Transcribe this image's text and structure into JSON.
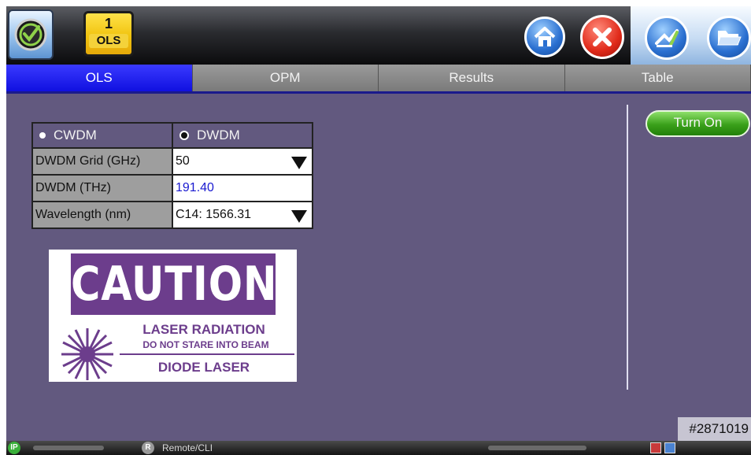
{
  "header": {
    "test_number": "1",
    "test_label": "OLS",
    "icons": [
      "logo-check-icon",
      "home-icon",
      "close-icon",
      "quick-launch-icon",
      "folder-icon"
    ]
  },
  "tabs": [
    {
      "label": "OLS",
      "active": true
    },
    {
      "label": "OPM",
      "active": false
    },
    {
      "label": "Results",
      "active": false
    },
    {
      "label": "Table",
      "active": false
    }
  ],
  "form": {
    "mode_options": [
      {
        "label": "CWDM",
        "selected": false
      },
      {
        "label": "DWDM",
        "selected": true
      }
    ],
    "grid_label": "DWDM Grid (GHz)",
    "grid_value": "50",
    "thz_label": "DWDM (THz)",
    "thz_value": "191.40",
    "wavelength_label": "Wavelength (nm)",
    "wavelength_value": "C14: 1566.31"
  },
  "actions": {
    "turn_on_label": "Turn On"
  },
  "caution": {
    "title": "CAUTION",
    "line1": "LASER RADIATION",
    "line2": "DO NOT STARE INTO BEAM",
    "line3": "DIODE LASER"
  },
  "id_label": "#2871019",
  "statusbar": {
    "ip_badge": "IP",
    "remote_badge": "R",
    "remote_label": "Remote/CLI"
  },
  "colors": {
    "background": "#62597f",
    "active_tab": "#1a1af0",
    "turn_on": "#3aa01a",
    "caution_purple": "#6c3d8c"
  }
}
